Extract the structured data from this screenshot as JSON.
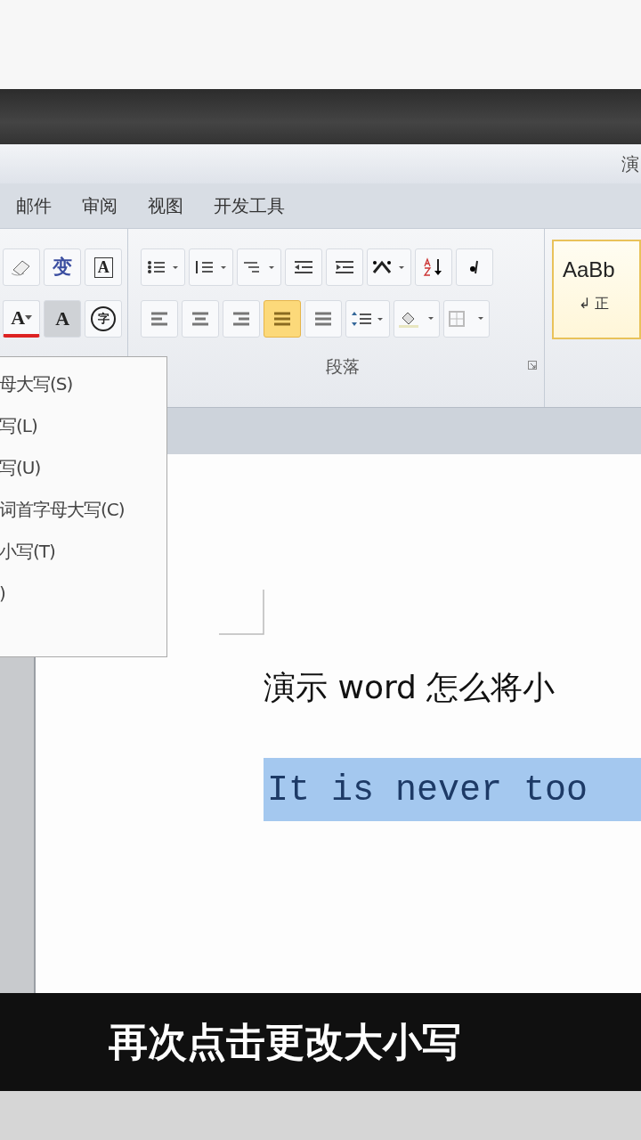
{
  "window": {
    "title": "演"
  },
  "tabs": [
    {
      "label": "邮件",
      "selected": false
    },
    {
      "label": "审阅",
      "selected": false
    },
    {
      "label": "视图",
      "selected": false
    },
    {
      "label": "开发工具",
      "selected": false
    }
  ],
  "font_group": {
    "row_1": [
      "变",
      "A"
    ],
    "row_2": [
      "A",
      "A",
      "字"
    ]
  },
  "paragraph": {
    "label": "段落",
    "alignment": [
      {
        "selected": false
      },
      {
        "selected": false
      },
      {
        "selected": false
      },
      {
        "selected": true
      },
      {
        "selected": false
      }
    ]
  },
  "styles": {
    "preview": "AaBb",
    "name": "↲ 正"
  },
  "case_menu": {
    "items": [
      {
        "label": "母大写(S)"
      },
      {
        "label": "写(L)"
      },
      {
        "label": "写(U)"
      },
      {
        "label": "词首字母大写(C)"
      },
      {
        "label": "小写(T)"
      },
      {
        "label": ")"
      }
    ]
  },
  "document": {
    "heading": "演示 word 怎么将小",
    "line": {
      "text": "It is never too",
      "selected": true
    }
  },
  "subtitle": "再次点击更改大小写"
}
